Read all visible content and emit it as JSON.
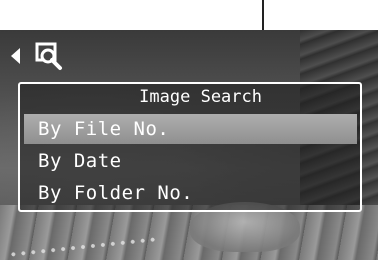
{
  "menu": {
    "title": "Image Search",
    "items": [
      {
        "label": "By File No.",
        "selected": true
      },
      {
        "label": "By Date",
        "selected": false
      },
      {
        "label": "By Folder No.",
        "selected": false
      }
    ]
  },
  "icons": {
    "back": "left-arrow-icon",
    "search": "image-search-icon"
  },
  "colors": {
    "text": "#ffffff",
    "selection": "#9e9e9e",
    "border": "#ffffff"
  }
}
